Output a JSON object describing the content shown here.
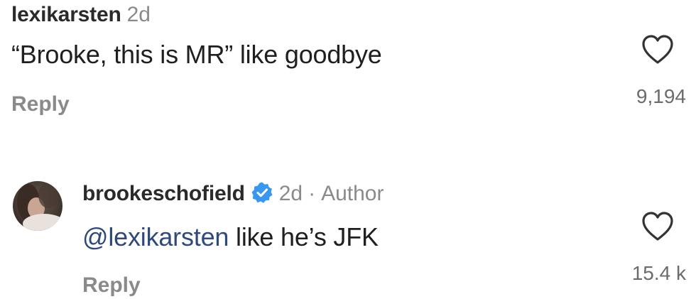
{
  "comments": [
    {
      "username": "lexikarsten",
      "time": "2d",
      "text": "“Brooke, this is MR” like goodbye",
      "reply_label": "Reply",
      "like_count": "9,194",
      "heart_icon": "heart-outline-icon"
    },
    {
      "username": "brookeschofield",
      "verified": true,
      "time": "2d",
      "separator": "·",
      "author_label": "Author",
      "mention": "@lexikarsten",
      "text_rest": " like he’s JFK",
      "reply_label": "Reply",
      "like_count": "15.4 k",
      "heart_icon": "heart-outline-icon",
      "avatar_icon": "profile-avatar"
    }
  ],
  "colors": {
    "verified_badge": "#3897f0",
    "mention": "#2e4a7a",
    "muted": "#8a8a8a"
  }
}
